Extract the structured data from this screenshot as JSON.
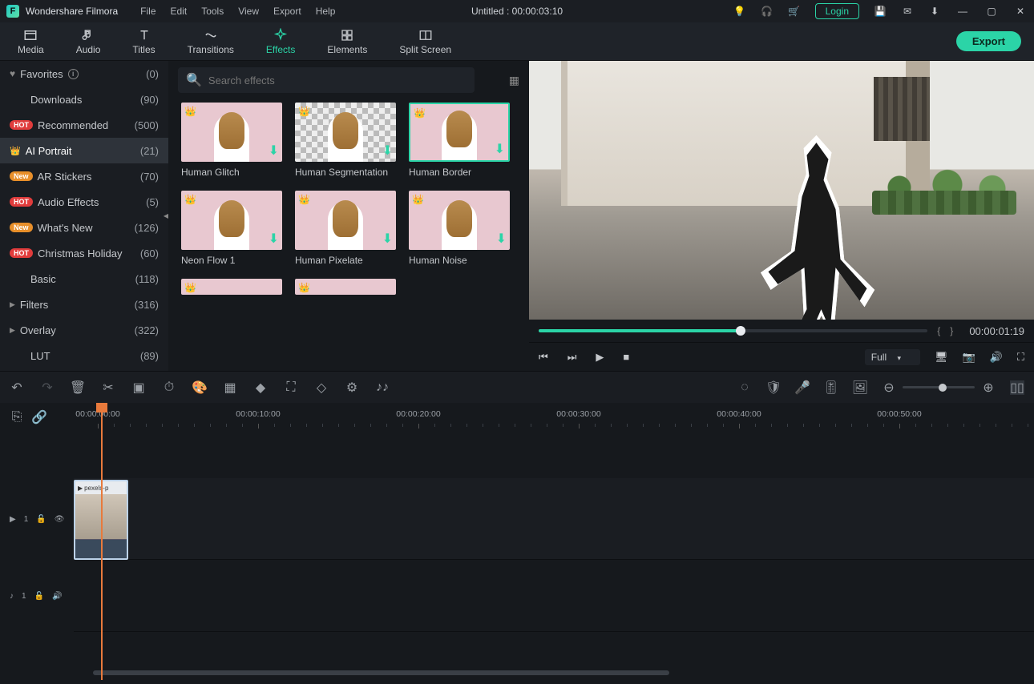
{
  "titlebar": {
    "app_name": "Wondershare Filmora",
    "menus": [
      "File",
      "Edit",
      "Tools",
      "View",
      "Export",
      "Help"
    ],
    "project_title": "Untitled : 00:00:03:10",
    "login_label": "Login"
  },
  "top_nav": {
    "tabs": [
      {
        "label": "Media"
      },
      {
        "label": "Audio"
      },
      {
        "label": "Titles"
      },
      {
        "label": "Transitions"
      },
      {
        "label": "Effects"
      },
      {
        "label": "Elements"
      },
      {
        "label": "Split Screen"
      }
    ],
    "active_tab": "Effects",
    "export_label": "Export"
  },
  "sidebar": {
    "items": [
      {
        "label": "Favorites",
        "count": "(0)",
        "icon": "heart",
        "info": true
      },
      {
        "label": "Downloads",
        "count": "(90)"
      },
      {
        "label": "Recommended",
        "count": "(500)",
        "badge": "HOT"
      },
      {
        "label": "AI Portrait",
        "count": "(21)",
        "icon": "crown",
        "active": true
      },
      {
        "label": "AR Stickers",
        "count": "(70)",
        "badge": "New"
      },
      {
        "label": "Audio Effects",
        "count": "(5)",
        "badge": "HOT"
      },
      {
        "label": "What's New",
        "count": "(126)",
        "badge": "New"
      },
      {
        "label": "Christmas Holiday",
        "count": "(60)",
        "badge": "HOT"
      },
      {
        "label": "Basic",
        "count": "(118)"
      },
      {
        "label": "Filters",
        "count": "(316)",
        "expand": true
      },
      {
        "label": "Overlay",
        "count": "(322)",
        "expand": true
      },
      {
        "label": "LUT",
        "count": "(89)"
      }
    ]
  },
  "effects": {
    "search_placeholder": "Search effects",
    "cards": [
      {
        "label": "Human Glitch",
        "crown": true,
        "dl": true
      },
      {
        "label": "Human Segmentation",
        "crown": true,
        "dl": true,
        "checker": true
      },
      {
        "label": "Human Border",
        "crown": true,
        "dl": true,
        "selected": true
      },
      {
        "label": "Neon Flow 1",
        "crown": true,
        "dl": true
      },
      {
        "label": "Human Pixelate",
        "crown": true,
        "dl": true
      },
      {
        "label": "Human Noise",
        "crown": true,
        "dl": true
      }
    ]
  },
  "preview": {
    "time": "00:00:01:19",
    "quality": "Full"
  },
  "timeline": {
    "marks": [
      "00:00:00:00",
      "00:00:10:00",
      "00:00:20:00",
      "00:00:30:00",
      "00:00:40:00",
      "00:00:50:00"
    ],
    "clip_name": "pexels-p",
    "video_track_label": "1",
    "audio_track_label": "1"
  }
}
